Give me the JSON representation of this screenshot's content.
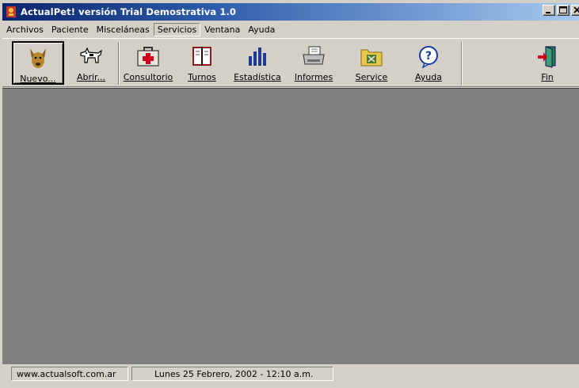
{
  "window": {
    "title": "ActualPet! versión Trial Demostrativa 1.0"
  },
  "menu": [
    {
      "label": "Archivos"
    },
    {
      "label": "Paciente"
    },
    {
      "label": "Misceláneas"
    },
    {
      "label": "Servicios"
    },
    {
      "label": "Ventana"
    },
    {
      "label": "Ayuda"
    }
  ],
  "toolbar": {
    "buttons": [
      {
        "label": "Nuevo...",
        "icon": "dog-head-icon"
      },
      {
        "label": "Abrir...",
        "icon": "dog-icon"
      },
      {
        "label": "Consultorio",
        "icon": "medical-kit-icon"
      },
      {
        "label": "Turnos",
        "icon": "appointment-book-icon"
      },
      {
        "label": "Estadística",
        "icon": "bar-chart-icon"
      },
      {
        "label": "Informes",
        "icon": "printer-icon"
      },
      {
        "label": "Service",
        "icon": "tools-icon"
      },
      {
        "label": "Ayuda",
        "icon": "help-icon"
      },
      {
        "label": "Fin",
        "icon": "exit-door-icon"
      }
    ]
  },
  "status": {
    "website": "www.actualsoft.com.ar",
    "datetime": "Lunes 25 Febrero, 2002 - 12:10 a.m."
  },
  "colors": {
    "title_start": "#0a246a",
    "title_end": "#a6caf0",
    "face": "#d4d0c8",
    "workspace": "#808080"
  }
}
